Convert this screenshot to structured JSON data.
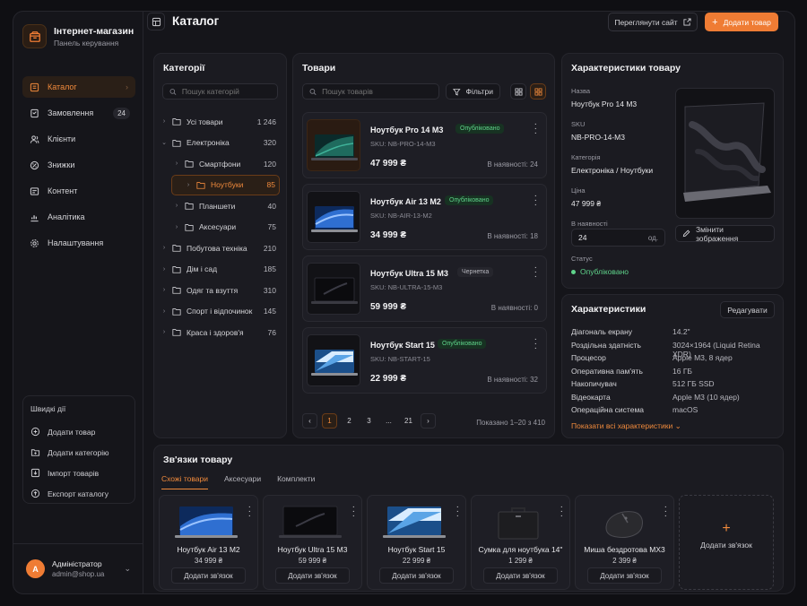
{
  "brand": {
    "title": "Інтернет-магазин",
    "subtitle": "Панель керування"
  },
  "nav": [
    {
      "label": "Каталог",
      "icon": "catalog-icon",
      "active": true
    },
    {
      "label": "Замовлення",
      "icon": "orders-icon",
      "badge": "24"
    },
    {
      "label": "Клієнти",
      "icon": "users-icon"
    },
    {
      "label": "Знижки",
      "icon": "discount-icon"
    },
    {
      "label": "Контент",
      "icon": "content-icon"
    },
    {
      "label": "Аналітика",
      "icon": "analytics-icon"
    },
    {
      "label": "Налаштування",
      "icon": "gear-icon"
    }
  ],
  "quick": {
    "title": "Швидкі дії",
    "items": [
      "Додати товар",
      "Додати категорію",
      "Імпорт товарів",
      "Експорт каталогу"
    ]
  },
  "user": {
    "initial": "А",
    "name": "Адміністратор",
    "email": "admin@shop.ua"
  },
  "header": {
    "title": "Каталог",
    "view_site": "Переглянути сайт",
    "add_product": "Додати товар"
  },
  "categories": {
    "title": "Категорії",
    "search_placeholder": "Пошук категорій",
    "items": [
      {
        "label": "Усі товари",
        "count": "1 246",
        "level": 0,
        "arrow": "›"
      },
      {
        "label": "Електроніка",
        "count": "320",
        "level": 0,
        "arrow": "⌄"
      },
      {
        "label": "Смартфони",
        "count": "120",
        "level": 1,
        "arrow": "›"
      },
      {
        "label": "Ноутбуки",
        "count": "85",
        "level": 1,
        "arrow": "›",
        "active": true
      },
      {
        "label": "Планшети",
        "count": "40",
        "level": 1,
        "arrow": "›"
      },
      {
        "label": "Аксесуари",
        "count": "75",
        "level": 1,
        "arrow": "›"
      },
      {
        "label": "Побутова техніка",
        "count": "210",
        "level": 0,
        "arrow": "›"
      },
      {
        "label": "Дім і сад",
        "count": "185",
        "level": 0,
        "arrow": "›"
      },
      {
        "label": "Одяг та взуття",
        "count": "310",
        "level": 0,
        "arrow": "›"
      },
      {
        "label": "Спорт і відпочинок",
        "count": "145",
        "level": 0,
        "arrow": "›"
      },
      {
        "label": "Краса і здоров'я",
        "count": "76",
        "level": 0,
        "arrow": "›"
      }
    ]
  },
  "products": {
    "title": "Товари",
    "search_placeholder": "Пошук товарів",
    "filters": "Фільтри",
    "items": [
      {
        "name": "Ноутбук Pro 14 M3",
        "status": "Опубліковано",
        "sku": "SKU: NB-PRO-14-M3",
        "price": "47 999 ₴",
        "stock": "В наявності: 24",
        "active": true
      },
      {
        "name": "Ноутбук Air 13 M2",
        "status": "Опубліковано",
        "sku": "SKU: NB-AIR-13-M2",
        "price": "34 999 ₴",
        "stock": "В наявності: 18"
      },
      {
        "name": "Ноутбук Ultra 15 M3",
        "status": "Чернетка",
        "sku": "SKU: NB-ULTRA-15-M3",
        "price": "59 999 ₴",
        "stock": "В наявності: 0"
      },
      {
        "name": "Ноутбук Start 15",
        "status": "Опубліковано",
        "sku": "SKU: NB-START-15",
        "price": "22 999 ₴",
        "stock": "В наявності: 32"
      }
    ],
    "pages": [
      "1",
      "2",
      "3",
      "...",
      "21"
    ],
    "pager_info": "Показано 1–20 з 410"
  },
  "details": {
    "title": "Характеристики товару",
    "name_label": "Назва",
    "name": "Ноутбук Pro 14 M3",
    "sku_label": "SKU",
    "sku": "NB-PRO-14-M3",
    "category_label": "Категорія",
    "category": "Електроніка / Ноутбуки",
    "price_label": "Ціна",
    "price": "47 999 ₴",
    "stock_label": "В наявності",
    "stock": "24",
    "stock_unit": "од.",
    "status_label": "Статус",
    "status": "Опубліковано",
    "change_image": "Змінити зображення"
  },
  "specs": {
    "title": "Характеристики",
    "edit": "Редагувати",
    "rows": [
      {
        "k": "Діагональ екрану",
        "v": "14.2\""
      },
      {
        "k": "Роздільна здатність",
        "v": "3024×1964 (Liquid Retina XDR)"
      },
      {
        "k": "Процесор",
        "v": "Apple M3, 8 ядер"
      },
      {
        "k": "Оперативна пам'ять",
        "v": "16 ГБ"
      },
      {
        "k": "Накопичувач",
        "v": "512 ГБ SSD"
      },
      {
        "k": "Відеокарта",
        "v": "Apple M3 (10 ядер)"
      },
      {
        "k": "Операційна система",
        "v": "macOS"
      }
    ],
    "show_all": "Показати всі характеристики"
  },
  "relations": {
    "title": "Зв'язки товару",
    "tabs": [
      "Схожі товари",
      "Аксесуари",
      "Комплекти"
    ],
    "items": [
      {
        "name": "Ноутбук Air 13 M2",
        "price": "34 999 ₴",
        "kind": "laptop-blue"
      },
      {
        "name": "Ноутбук Ultra 15 M3",
        "price": "59 999 ₴",
        "kind": "laptop-dark"
      },
      {
        "name": "Ноутбук Start 15",
        "price": "22 999 ₴",
        "kind": "laptop-light"
      },
      {
        "name": "Сумка для ноутбука 14\"",
        "price": "1 299 ₴",
        "kind": "bag"
      },
      {
        "name": "Миша бездротова MX3",
        "price": "2 399 ₴",
        "kind": "mouse"
      }
    ],
    "add_button": "Додати зв'язок",
    "add_card": "Додати зв'язок"
  },
  "colors": {
    "accent": "#ef7c34",
    "success": "#5fd38a",
    "panel": "#1b1b21",
    "background": "#0f0f13"
  }
}
